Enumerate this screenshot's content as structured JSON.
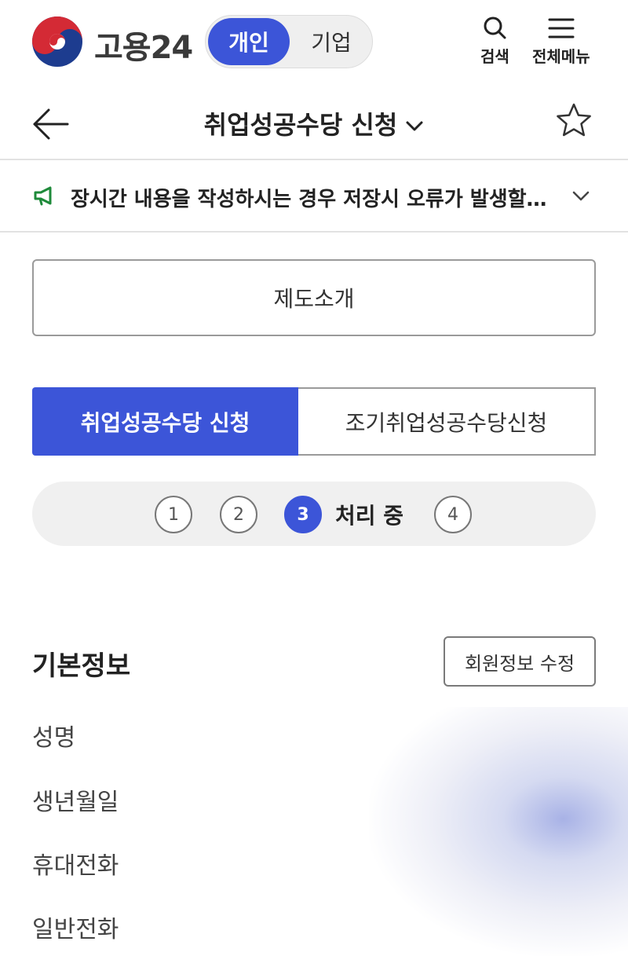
{
  "header": {
    "brand": "고용24",
    "mode_active": "개인",
    "mode_inactive": "기업",
    "search_label": "검색",
    "menu_label": "전체메뉴",
    "colors": {
      "primary": "#3c55d8"
    }
  },
  "titlebar": {
    "title": "취업성공수당 신청"
  },
  "notice": {
    "text": "장시간 내용을 작성하시는 경우 저장시 오류가 발생할…"
  },
  "intro_button": "제도소개",
  "tabs": [
    {
      "label": "취업성공수당 신청",
      "active": true
    },
    {
      "label": "조기취업성공수당신청",
      "active": false
    }
  ],
  "steps": {
    "items": [
      "1",
      "2",
      "3",
      "4"
    ],
    "current": "3",
    "current_label": "처리 중"
  },
  "basic_info": {
    "title": "기본정보",
    "edit_button": "회원정보 수정",
    "fields": [
      "성명",
      "생년월일",
      "휴대전화",
      "일반전화"
    ]
  }
}
